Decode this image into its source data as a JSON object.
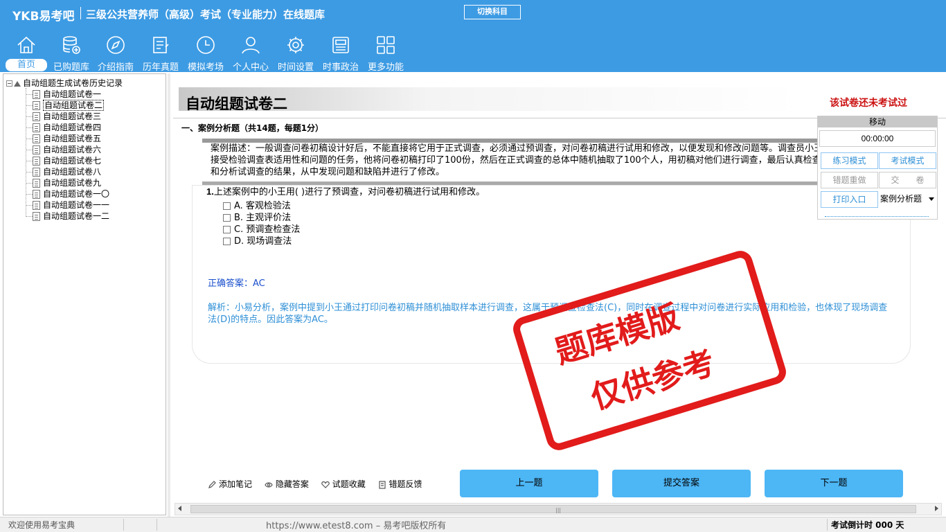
{
  "app": {
    "logo": "YKB易考吧",
    "title": "三级公共营养师（高级）考试（专业能力）在线题库",
    "switch_subject": "切换科目"
  },
  "nav": [
    {
      "label": "首页",
      "icon": "home-icon",
      "active": true
    },
    {
      "label": "已购题库",
      "icon": "database-icon"
    },
    {
      "label": "介绍指南",
      "icon": "compass-icon"
    },
    {
      "label": "历年真题",
      "icon": "list-icon"
    },
    {
      "label": "模拟考场",
      "icon": "clock-icon"
    },
    {
      "label": "个人中心",
      "icon": "user-icon"
    },
    {
      "label": "时间设置",
      "icon": "gear-icon"
    },
    {
      "label": "时事政治",
      "icon": "newspaper-icon"
    },
    {
      "label": "更多功能",
      "icon": "grid-icon"
    }
  ],
  "tree": {
    "root": "自动组题生成试卷历史记录",
    "items": [
      "自动组题试卷一",
      "自动组题试卷二",
      "自动组题试卷三",
      "自动组题试卷四",
      "自动组题试卷五",
      "自动组题试卷六",
      "自动组题试卷七",
      "自动组题试卷八",
      "自动组题试卷九",
      "自动组题试卷一〇",
      "自动组题试卷一一",
      "自动组题试卷一二"
    ],
    "selected_index": 1
  },
  "paper": {
    "title": "自动组题试卷二",
    "status": "该试卷还未考试过",
    "section": "一、案例分析题（共14题，每题1分）",
    "case": "案例描述：一般调查问卷初稿设计好后，不能直接将它用于正式调查，必须通过预调查，对问卷初稿进行试用和修改，以便发现和修改问题等。调查员小王接受检验调查表适用性和问题的任务，他将问卷初稿打印了100份，然后在正式调查的总体中随机抽取了100个人，用初稿对他们进行调查，最后认真检查和分析试调查的结果，从中发现问题和缺陷并进行了修改。",
    "question_num": "1.",
    "question": "上述案例中的小王用(  )进行了预调查，对问卷初稿进行试用和修改。",
    "options": [
      "A. 客观检验法",
      "B. 主观评价法",
      "C. 预调查检查法",
      "D. 现场调查法"
    ],
    "correct": "正确答案：AC",
    "analysis": "解析：小易分析，案例中提到小王通过打印问卷初稿并随机抽取样本进行调查，这属于预调查检查法(C)，同时在调查过程中对问卷进行实际应用和检验，也体现了现场调查法(D)的特点。因此答案为AC。",
    "stamp_line1": "题库模版",
    "stamp_line2": "仅供参考"
  },
  "tools": [
    "添加笔记",
    "隐藏答案",
    "试题收藏",
    "错题反馈"
  ],
  "buttons": {
    "prev": "上一题",
    "submit": "提交答案",
    "next": "下一题"
  },
  "panel": {
    "header": "移动",
    "timer": "00:00:00",
    "practice": "练习模式",
    "exam": "考试模式",
    "redo": "错题重做",
    "hand_in": "交　　卷",
    "print": "打印入口",
    "type_select": "案例分析题"
  },
  "status": {
    "welcome": "欢迎使用易考宝典",
    "copyright": "https://www.etest8.com – 易考吧版权所有",
    "countdown": "考试倒计时 000 天"
  },
  "colors": {
    "brand": "#3d9be3",
    "button": "#4db6f5",
    "stamp": "#e21b1b",
    "answer": "#1a4fcc",
    "analysis": "#2e8fd6",
    "status_red": "#cc1111"
  }
}
